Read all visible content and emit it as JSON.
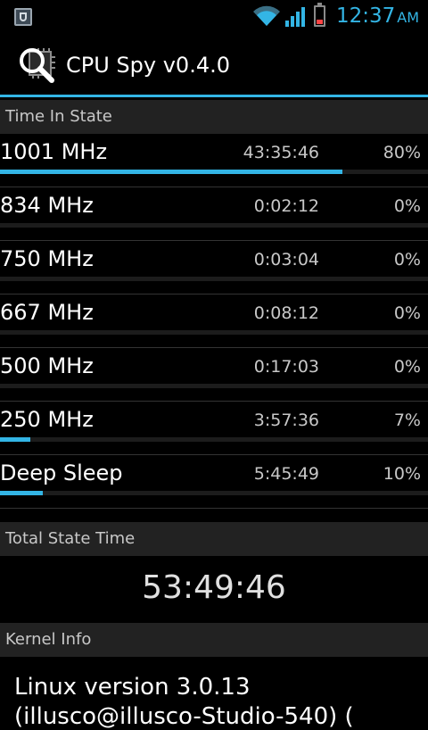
{
  "status_bar": {
    "time": "12:37",
    "ampm": "AM",
    "notification_icon": "security-shield-icon",
    "wifi_icon": "wifi-icon",
    "signal_icon": "signal-icon",
    "battery_icon": "battery-low-icon",
    "accent_color": "#33b5e5"
  },
  "action_bar": {
    "title": "CPU Spy v0.4.0",
    "icon": "cpu-magnifier-icon"
  },
  "time_in_state": {
    "header": "Time In State",
    "states": [
      {
        "name": "1001 MHz",
        "time": "43:35:46",
        "percent": "80%",
        "fraction": 0.8
      },
      {
        "name": "834 MHz",
        "time": "0:02:12",
        "percent": "0%",
        "fraction": 0.0
      },
      {
        "name": "750 MHz",
        "time": "0:03:04",
        "percent": "0%",
        "fraction": 0.0
      },
      {
        "name": "667 MHz",
        "time": "0:08:12",
        "percent": "0%",
        "fraction": 0.0
      },
      {
        "name": "500 MHz",
        "time": "0:17:03",
        "percent": "0%",
        "fraction": 0.0
      },
      {
        "name": "250 MHz",
        "time": "3:57:36",
        "percent": "7%",
        "fraction": 0.07
      },
      {
        "name": "Deep Sleep",
        "time": "5:45:49",
        "percent": "10%",
        "fraction": 0.1
      }
    ]
  },
  "total_state_time": {
    "header": "Total State Time",
    "value": "53:49:46"
  },
  "kernel_info": {
    "header": "Kernel Info",
    "line1": "Linux version 3.0.13",
    "line2": "(illusco@illusco-Studio-540) ("
  }
}
